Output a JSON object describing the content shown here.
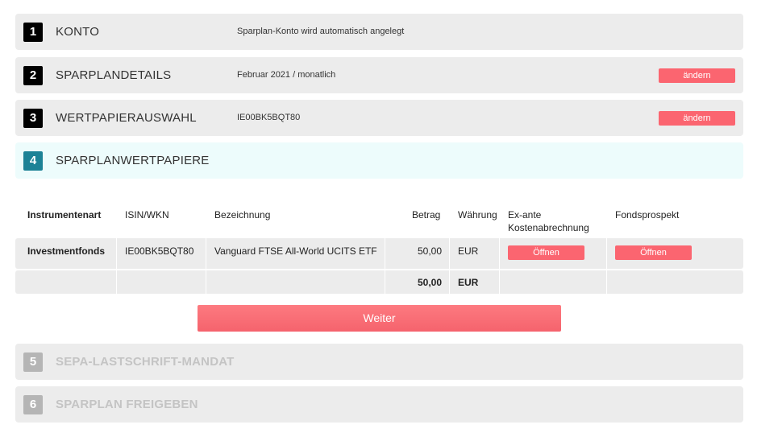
{
  "steps": [
    {
      "num": "1",
      "title": "KONTO",
      "info": "Sparplan-Konto wird automatisch angelegt"
    },
    {
      "num": "2",
      "title": "SPARPLANDETAILS",
      "info": "Februar 2021 / monatlich",
      "edit_label": "ändern"
    },
    {
      "num": "3",
      "title": "WERTPAPIERAUSWAHL",
      "info": "IE00BK5BQT80",
      "edit_label": "ändern"
    },
    {
      "num": "4",
      "title": "SPARPLANWERTPAPIERE"
    },
    {
      "num": "5",
      "title": "SEPA-LASTSCHRIFT-MANDAT"
    },
    {
      "num": "6",
      "title": "SPARPLAN FREIGEBEN"
    }
  ],
  "table": {
    "headers": {
      "type": "Instrumentenart",
      "isin": "ISIN/WKN",
      "name": "Bezeichnung",
      "amount": "Betrag",
      "currency": "Währung",
      "costs_line1": "Ex-ante",
      "costs_line2": "Kostenabrechnung",
      "prospectus": "Fondsprospekt"
    },
    "rows": [
      {
        "type": "Investmentfonds",
        "isin": "IE00BK5BQT80",
        "name": "Vanguard FTSE All-World UCITS ETF",
        "amount": "50,00",
        "currency": "EUR",
        "costs_button": "Öffnen",
        "prospectus_button": "Öffnen"
      }
    ],
    "total": {
      "amount": "50,00",
      "currency": "EUR"
    }
  },
  "next_button": "Weiter",
  "colors": {
    "accent": "#fb6570",
    "active_step_bg": "#edfcfc",
    "active_step_number": "#1d8296",
    "step_bg": "#ececec",
    "disabled_text": "#c4c4c4"
  }
}
